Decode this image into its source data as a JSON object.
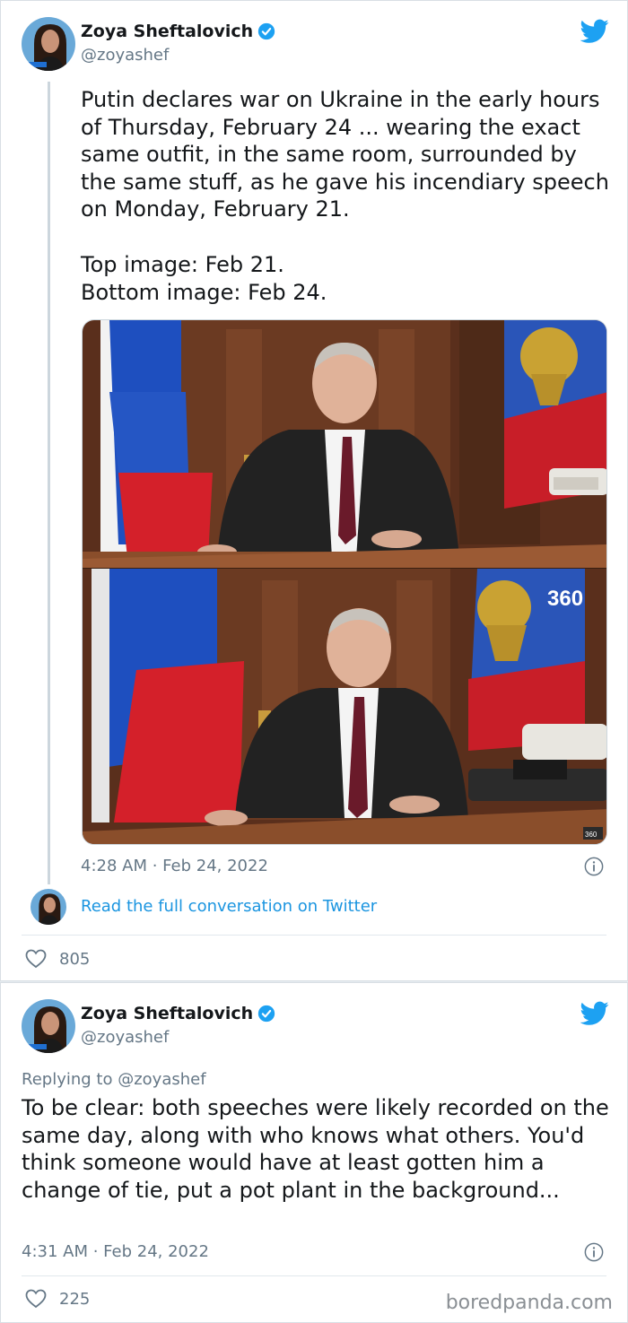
{
  "tweet1": {
    "author": {
      "name": "Zoya Sheftalovich",
      "handle": "@zoyashef",
      "verified": true
    },
    "paragraphs": [
      "Putin declares war on Ukraine in the early hours of Thursday, February 24 ... wearing the exact same outfit, in the same room, surrounded by the same stuff, as he gave his incendiary speech on Monday, February 21.",
      "Top image: Feb 21.\nBottom image: Feb 24."
    ],
    "images": {
      "top_badge": "",
      "bottom_badge": "360",
      "bottom_corner_badge": "360"
    },
    "timestamp": "4:28 AM · Feb 24, 2022",
    "read_full": "Read the full conversation on Twitter",
    "likes": "805"
  },
  "tweet2": {
    "author": {
      "name": "Zoya Sheftalovich",
      "handle": "@zoyashef",
      "verified": true
    },
    "replying_to": "Replying to @zoyashef",
    "text": "To be clear: both speeches were likely recorded on the same day, along with who knows what others. You'd think someone would have at least gotten him a change of tie, put a pot plant in the background...",
    "timestamp": "4:31 AM · Feb 24, 2022",
    "likes": "225"
  },
  "watermark": "boredpanda.com",
  "colors": {
    "twitter_blue": "#1da1f2",
    "link": "#1b95e0",
    "muted": "#657786"
  },
  "icons": [
    "twitter-bird-icon",
    "verified-badge-icon",
    "info-icon",
    "heart-icon"
  ]
}
